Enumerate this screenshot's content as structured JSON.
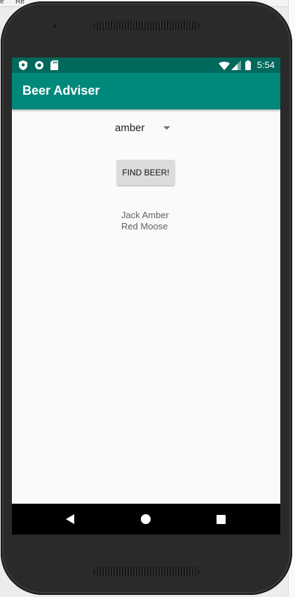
{
  "colors": {
    "status_bar": "#00695c",
    "app_bar": "#00897b",
    "screen_bg": "#fafafa",
    "button_bg": "#dcdcdc",
    "nav_bar": "#000000"
  },
  "desktop": {
    "fragment_left": "e",
    "fragment_mid": "Re"
  },
  "status_bar": {
    "left_icons": [
      "shield-icon",
      "circle-icon",
      "sd-card-icon"
    ],
    "right_icons": [
      "wifi-icon",
      "cell-signal-icon",
      "battery-icon"
    ],
    "time": "5:54"
  },
  "app_bar": {
    "title": "Beer Adviser"
  },
  "main": {
    "color_spinner": {
      "selected": "amber",
      "icon": "dropdown-arrow-icon"
    },
    "find_button_label": "FIND BEER!",
    "brands": [
      "Jack Amber",
      "Red Moose"
    ]
  },
  "nav_bar": {
    "buttons": [
      "back-icon",
      "home-icon",
      "recents-icon"
    ]
  }
}
